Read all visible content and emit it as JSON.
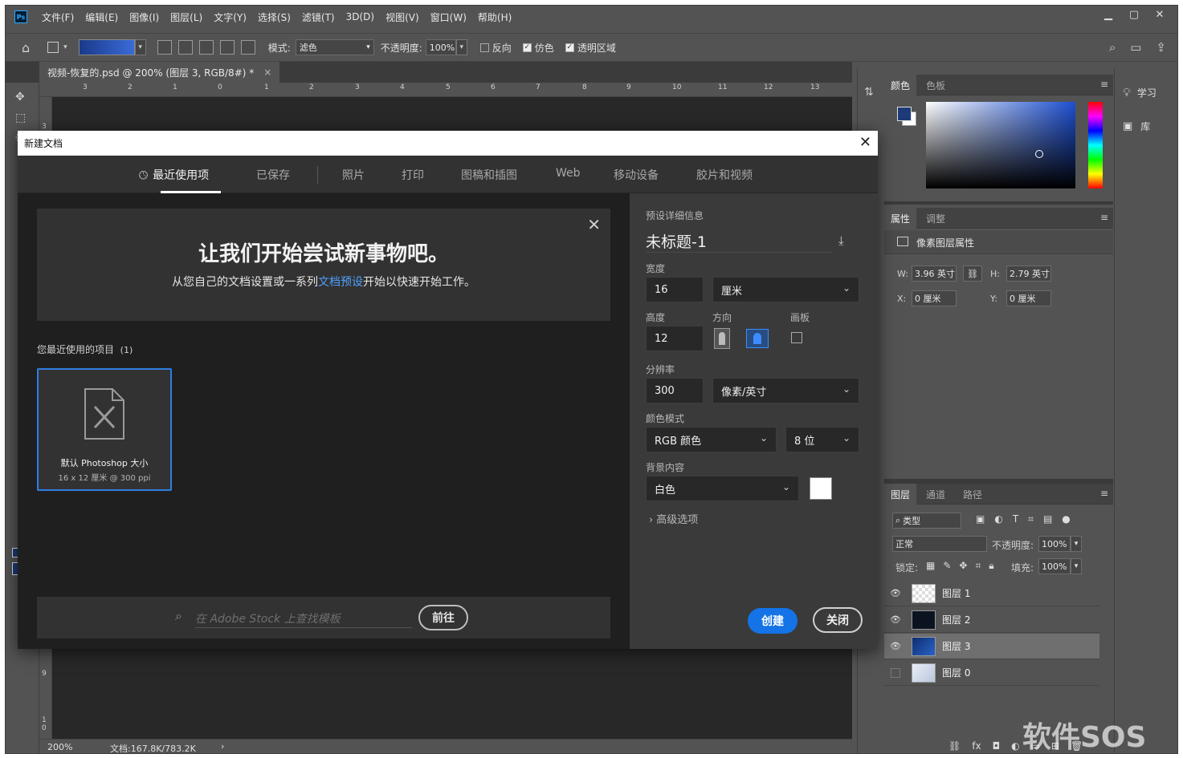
{
  "app": {
    "logo": "Ps"
  },
  "menu": [
    "文件(F)",
    "编辑(E)",
    "图像(I)",
    "图层(L)",
    "文字(Y)",
    "选择(S)",
    "滤镜(T)",
    "3D(D)",
    "视图(V)",
    "窗口(W)",
    "帮助(H)"
  ],
  "options": {
    "mode_label": "模式:",
    "mode_value": "滤色",
    "opacity_label": "不透明度:",
    "opacity_value": "100%",
    "reverse_label": "反向",
    "dither_label": "仿色",
    "transparency_label": "透明区域",
    "reverse_checked": false,
    "dither_checked": true,
    "transparency_checked": true
  },
  "document": {
    "tab_title": "视频-恢复的.psd @ 200% (图层 3, RGB/8#) *",
    "tab_close": "×",
    "ruler_h": [
      "3",
      "2",
      "1",
      "0",
      "1",
      "2",
      "3",
      "4",
      "5",
      "6",
      "7",
      "8",
      "9",
      "10",
      "11",
      "12",
      "13"
    ],
    "ruler_v_top": "3",
    "ruler_v_mid": "9",
    "ruler_v_bottom": "1\n0",
    "zoom": "200%",
    "doc_info": "文档:167.8K/783.2K",
    "status_arrow": "›"
  },
  "color_panel": {
    "tabs": [
      "颜色",
      "色板"
    ],
    "foreground_color": "#1e3a78",
    "background_color": "#ffffff"
  },
  "properties_panel": {
    "tabs": [
      "属性",
      "调整"
    ],
    "section_title": "像素图层属性",
    "w_label": "W:",
    "w_value": "3.96 英寸",
    "h_label": "H:",
    "h_value": "2.79 英寸",
    "x_label": "X:",
    "x_value": "0 厘米",
    "y_label": "Y:",
    "y_value": "0 厘米"
  },
  "layers_panel": {
    "tabs": [
      "图层",
      "通道",
      "路径"
    ],
    "filter_label": "类型",
    "blend_mode": "正常",
    "opacity_label": "不透明度:",
    "opacity_value": "100%",
    "lock_label": "锁定:",
    "fill_label": "填充:",
    "fill_value": "100%",
    "layers": [
      {
        "name": "图层",
        "num": "1",
        "visible": true,
        "selected": false,
        "thumb": "transparent"
      },
      {
        "name": "图层",
        "num": "2",
        "visible": true,
        "selected": false,
        "thumb": "dark"
      },
      {
        "name": "图层",
        "num": "3",
        "visible": true,
        "selected": true,
        "thumb": "blue"
      },
      {
        "name": "图层",
        "num": "0",
        "visible": false,
        "selected": false,
        "thumb": "image"
      }
    ]
  },
  "learn_panel": {
    "learn": "学习",
    "library": "库"
  },
  "dialog": {
    "title": "新建文档",
    "tabs": [
      "最近使用项",
      "已保存",
      "照片",
      "打印",
      "图稿和插图",
      "Web",
      "移动设备",
      "胶片和视频"
    ],
    "hero_title": "让我们开始尝试新事物吧。",
    "hero_sub_before": "从您自己的文档设置或一系列",
    "hero_sub_link": "文档预设",
    "hero_sub_after": "开始以快速开始工作。",
    "recent_label": "您最近使用的项目",
    "recent_count": "(1)",
    "recent_item_title": "默认 Photoshop 大小",
    "recent_item_sub": "16 x 12 厘米 @ 300 ppi",
    "stock_placeholder": "在 Adobe Stock 上查找模板",
    "go_label": "前往",
    "preset_label": "预设详细信息",
    "doc_name": "未标题-1",
    "width_label": "宽度",
    "width_value": "16",
    "unit_value": "厘米",
    "height_label": "高度",
    "height_value": "12",
    "orientation_label": "方向",
    "artboard_label": "画板",
    "resolution_label": "分辨率",
    "resolution_value": "300",
    "resolution_unit": "像素/英寸",
    "color_mode_label": "颜色模式",
    "color_mode_value": "RGB 颜色",
    "bit_depth": "8 位",
    "bg_label": "背景内容",
    "bg_value": "白色",
    "advanced_label": "高级选项",
    "create_label": "创建",
    "close_label": "关闭"
  },
  "watermark": "软件SOS"
}
